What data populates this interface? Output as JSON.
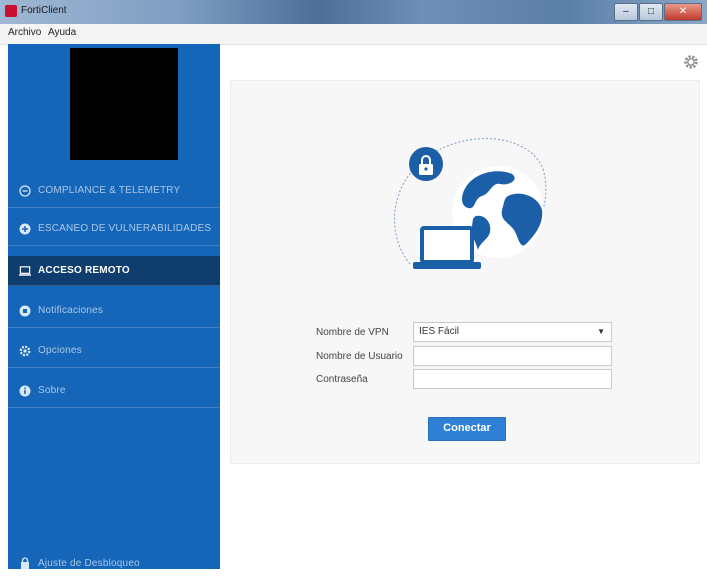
{
  "window": {
    "title": "FortiClient",
    "controls": [
      "–",
      "□",
      "✕"
    ]
  },
  "menu": {
    "items": [
      "Archivo",
      "Ayuda"
    ]
  },
  "sidebar": {
    "items": [
      {
        "label": "COMPLIANCE & TELEMETRY",
        "icon": "compliance-icon",
        "active": false
      },
      {
        "label": "ESCANEO DE VULNERABILIDADES",
        "icon": "vulnerability-scan-icon",
        "active": false
      },
      {
        "label": "ACCESO REMOTO",
        "icon": "remote-access-icon",
        "active": true
      },
      {
        "label": "Notificaciones",
        "icon": "notifications-icon",
        "active": false
      },
      {
        "label": "Opciones",
        "icon": "options-gear-icon",
        "active": false
      },
      {
        "label": "Sobre",
        "icon": "info-icon",
        "active": false
      }
    ],
    "footer_label": "Ajuste de Desbloqueo"
  },
  "vpn_form": {
    "vpn_name_label": "Nombre de VPN",
    "vpn_name_value": "IES Fácil",
    "username_label": "Nombre de Usuario",
    "username_value": "",
    "password_label": "Contraseña",
    "password_value": "",
    "connect_label": "Conectar"
  },
  "colors": {
    "sidebar_bg": "#1565b8",
    "sidebar_active": "#0f3d6e",
    "accent": "#2f7fd4",
    "illustration_blue": "#1a5fa8"
  }
}
